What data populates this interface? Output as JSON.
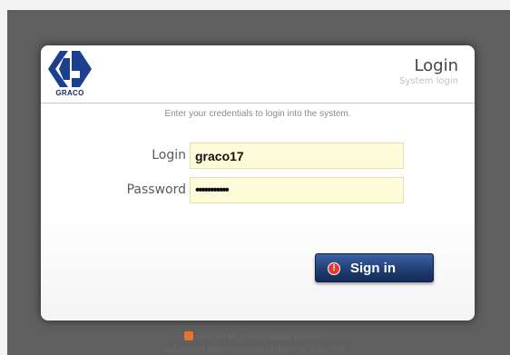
{
  "header": {
    "brand": "GRACO",
    "title": "Login",
    "subtitle": "System login"
  },
  "form": {
    "instructions": "Enter your credentials to login into the system.",
    "login_label": "Login",
    "login_value": "graco17",
    "password_label": "Password",
    "password_value": "•••••••••••"
  },
  "actions": {
    "signin_label": "Sign in"
  },
  "footer": {
    "browser_notice": "Use HTML5 compatible browser",
    "version": "Advanced Web Interface (AWI) Ver. 3.01.002"
  },
  "colors": {
    "backdrop": "#5f5f5f",
    "field_bg": "#fffdd9",
    "button": "#223e74",
    "brand_blue": "#1c3f8f"
  }
}
